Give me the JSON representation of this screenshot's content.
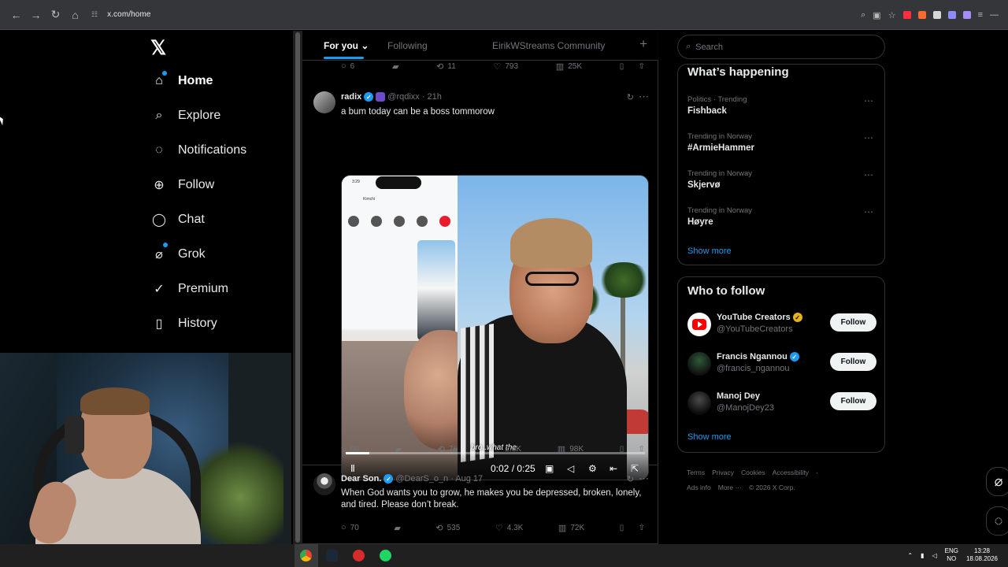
{
  "browser": {
    "url": "x.com/home",
    "nav": [
      "←",
      "→",
      "↻",
      "⌂"
    ],
    "site_info_icon": "site-info-icon",
    "extension_colors": [
      "#ff2d3d",
      "#f76b2c",
      "#d9a321",
      "#d7d7d7",
      "#8e8cf7",
      "#a68cf7"
    ]
  },
  "sidebar": {
    "logo": "𝕏",
    "items": [
      {
        "label": "Home",
        "icon": "⌂",
        "active": true
      },
      {
        "label": "Explore",
        "icon": "⌕"
      },
      {
        "label": "Notifications",
        "icon": "◌"
      },
      {
        "label": "Follow",
        "icon": "⊕"
      },
      {
        "label": "Chat",
        "icon": "◯"
      },
      {
        "label": "Grok",
        "icon": "⌀"
      },
      {
        "label": "Premium",
        "icon": "✓"
      },
      {
        "label": "History",
        "icon": "▯"
      }
    ]
  },
  "timeline": {
    "tabs": [
      "For you",
      "Following",
      "EirikWStreams Community"
    ],
    "plus": "+",
    "top_actions": [
      "6",
      "11",
      "793",
      "25K"
    ],
    "post1": {
      "author": "radix",
      "handle": "@rqdixx",
      "time": "· 21h",
      "text": "a bum today can be a boss tommorow",
      "subtitle": "bro..what the",
      "video_time": "0:02 / 0:25",
      "progress": 0.08,
      "actions": [
        "60",
        "76",
        "2.3K",
        "98K"
      ],
      "phone": {
        "time": "3:29",
        "caller": "Kimchi",
        "inset_label": ""
      }
    },
    "post2": {
      "author": "Dear Son.",
      "handle": "@DearS_o_n",
      "time": "· Aug 17",
      "text": "When God wants you to grow, he makes you be depressed, broken, lonely, and tired. Please don’t break.",
      "actions": [
        "70",
        "535",
        "4.3K",
        "72K"
      ]
    }
  },
  "right": {
    "search_placeholder": "Search",
    "happening_title": "What’s happening",
    "trends": [
      {
        "context": "Politics · Trending",
        "name": "Fishback"
      },
      {
        "context": "Trending in Norway",
        "name": "#ArmieHammer"
      },
      {
        "context": "Trending in Norway",
        "name": "Skjervø"
      },
      {
        "context": "Trending in Norway",
        "name": "Høyre"
      }
    ],
    "show_more": "Show more",
    "who_title": "Who to follow",
    "follow": [
      {
        "name": "YouTube Creators",
        "handle": "@YouTubeCreators",
        "badge": "gold"
      },
      {
        "name": "Francis Ngannou",
        "handle": "@francis_ngannou",
        "badge": "blue"
      },
      {
        "name": "Manoj Dey",
        "handle": "@ManojDey23",
        "badge": ""
      }
    ],
    "follow_label": "Follow",
    "footer": [
      "Terms",
      "Privacy",
      "Cookies",
      "Accessibility",
      "Ads info",
      "More ···",
      "© 2026 X Corp."
    ]
  },
  "taskbar": {
    "lang": "ENG",
    "region": "NO",
    "time": "13:28",
    "date": "18.08.2026"
  }
}
